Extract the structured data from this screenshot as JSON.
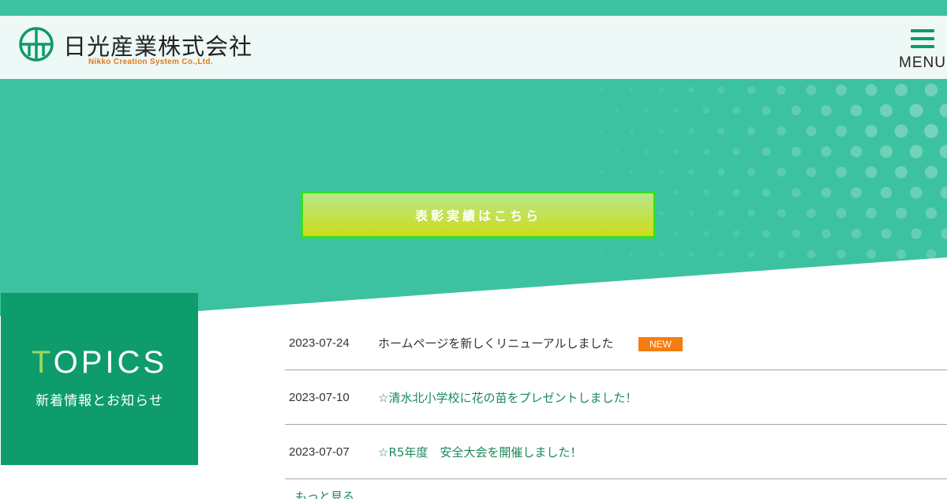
{
  "header": {
    "company_name": "日光産業株式会社",
    "company_name_en": "Nikko Creation System Co.,Ltd.",
    "menu_label": "MENU"
  },
  "hero": {
    "award_button_label": "表彰実績はこちら"
  },
  "topics": {
    "title_first": "T",
    "title_rest": "OPICS",
    "subtitle": "新着情報とお知らせ"
  },
  "news": [
    {
      "date": "2023-07-24",
      "title": "ホームページを新しくリニューアルしました",
      "badge": "NEW"
    },
    {
      "date": "2023-07-10",
      "title": "☆清水北小学校に花の苗をプレゼントしました！"
    },
    {
      "date": "2023-07-07",
      "title": "☆R5年度　安全大会を開催しました！"
    }
  ],
  "more_label": "もっと見る",
  "colors": {
    "teal": "#3cc2a0",
    "dark_green": "#0e9c6c",
    "orange": "#f57d0f",
    "lime": "#d0db1a"
  }
}
